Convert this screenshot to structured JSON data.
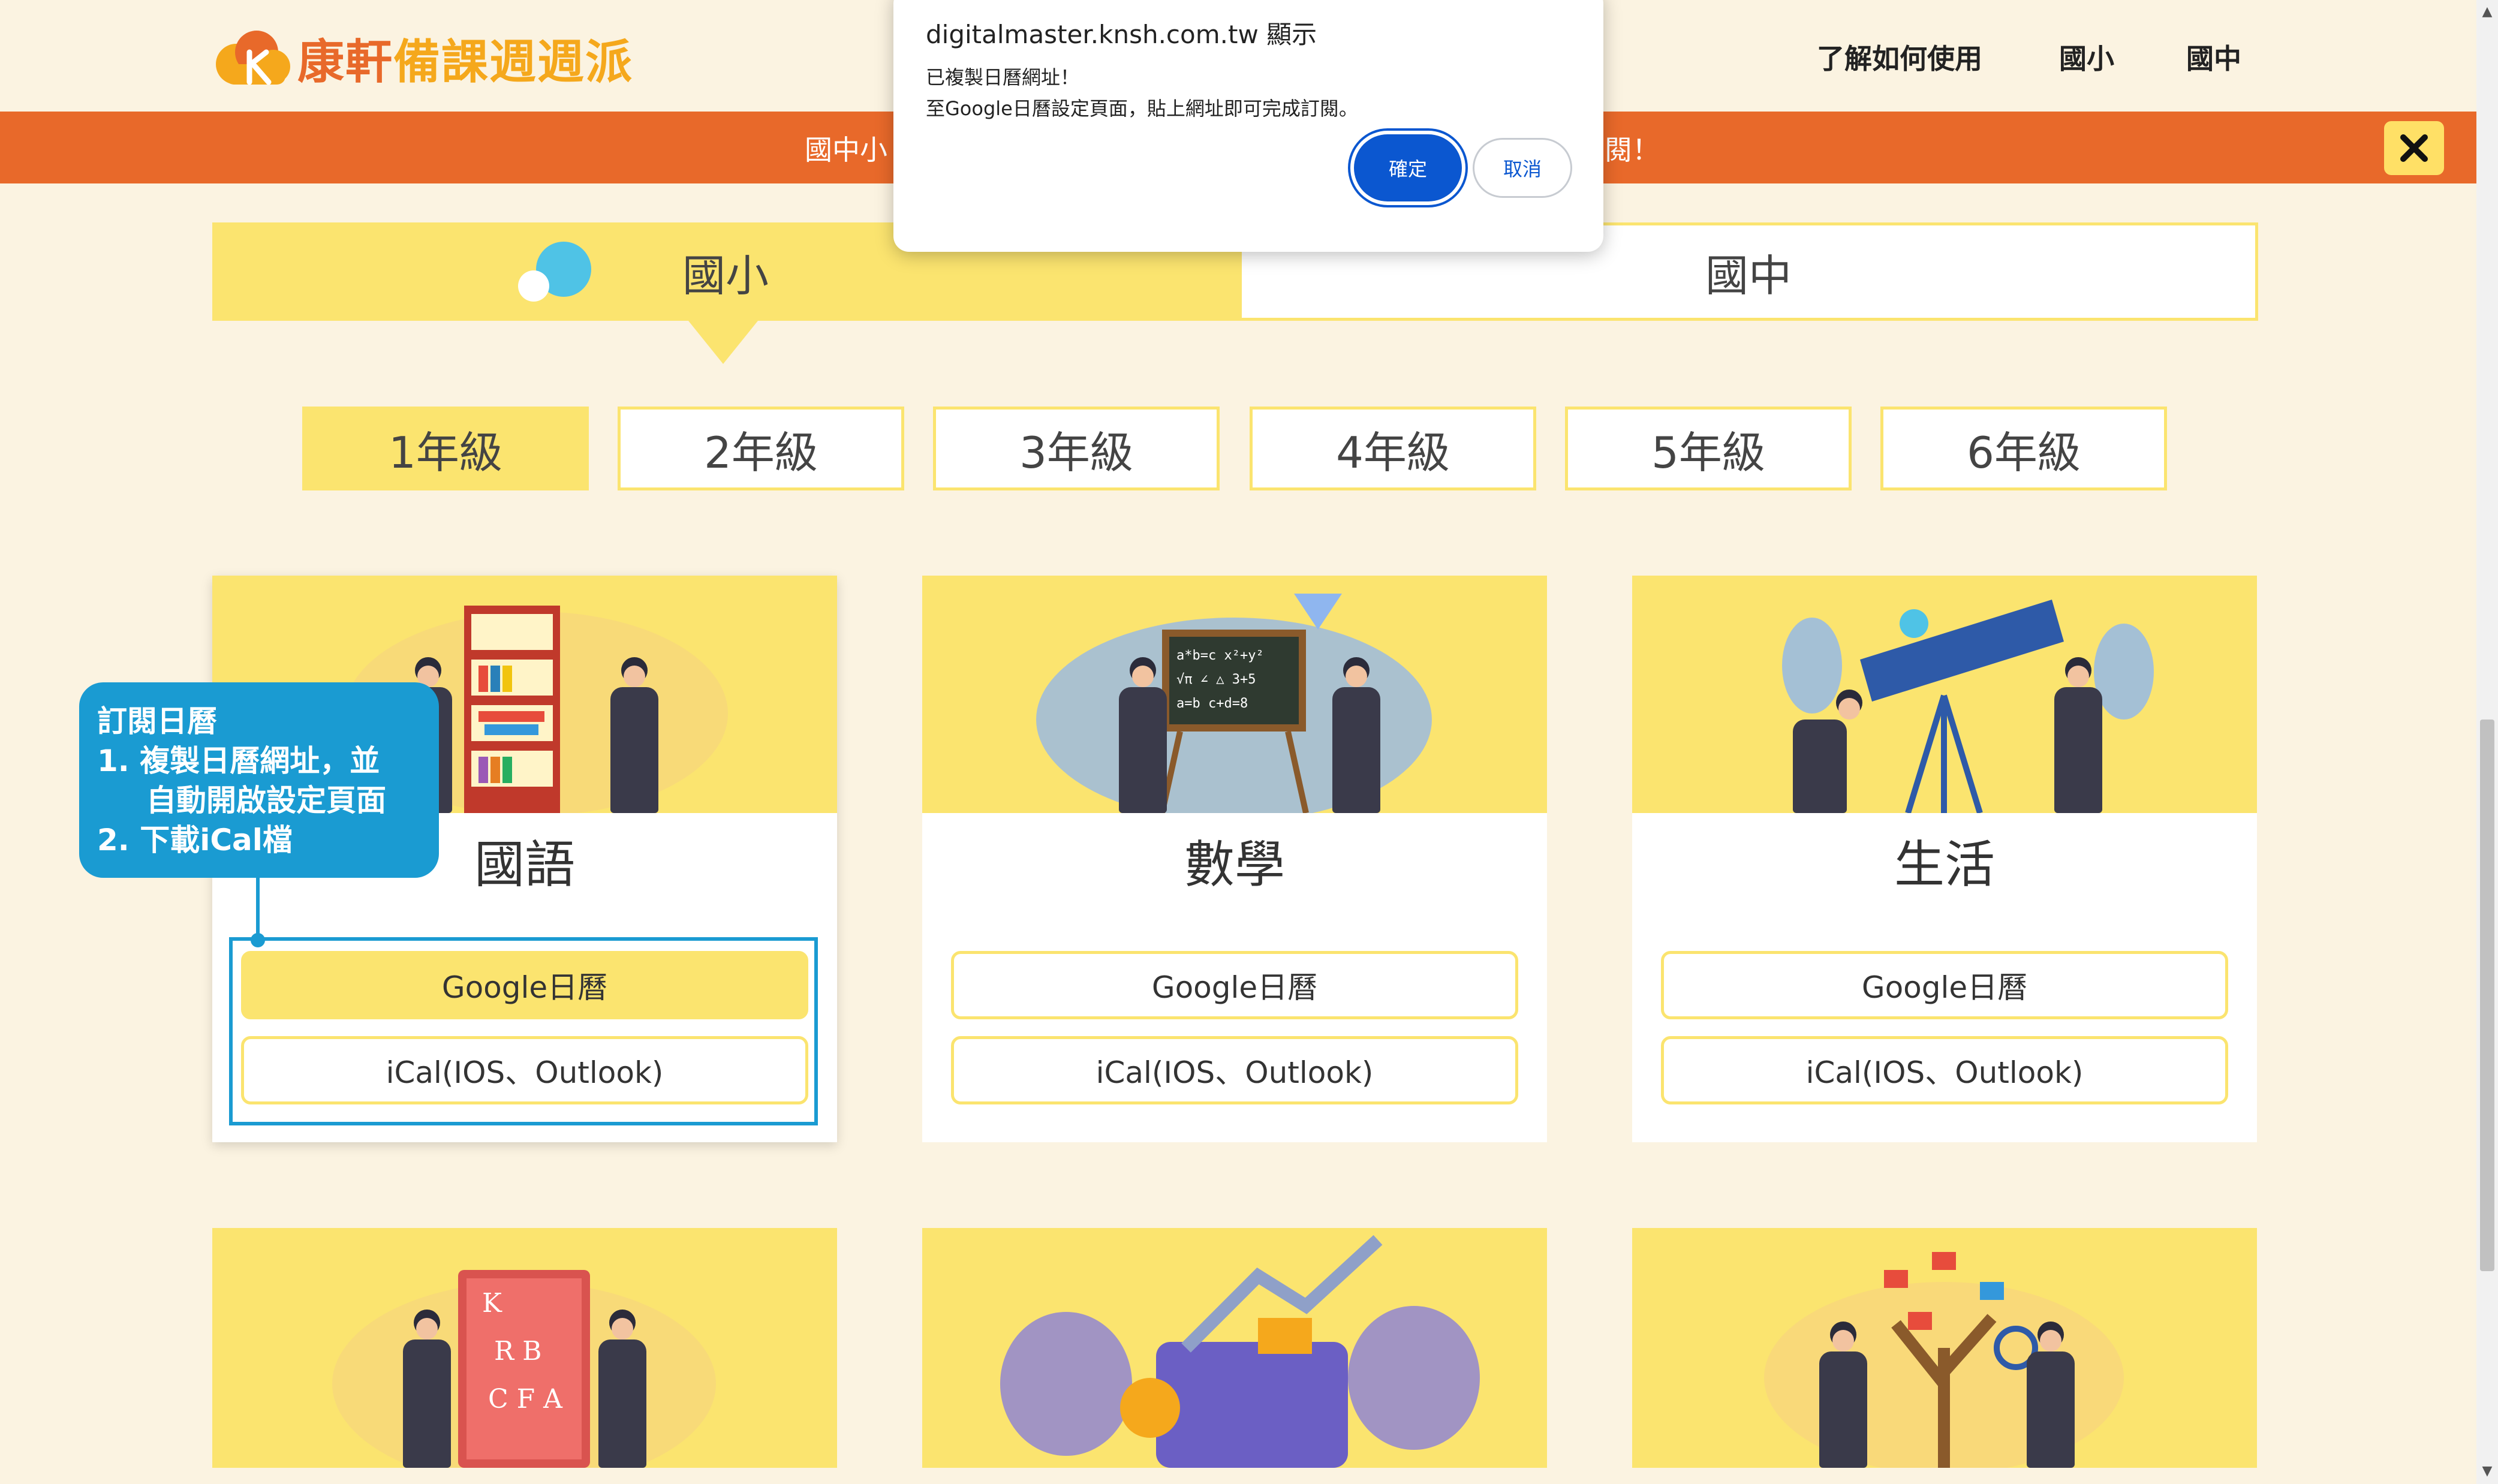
{
  "header": {
    "brand_main": "康軒",
    "brand_sub": "備課週週派",
    "nav": [
      "了解如何使用",
      "國小",
      "國中"
    ]
  },
  "banner": {
    "text_left": "國中小",
    "text_right": "閱！"
  },
  "dialog": {
    "title": "digitalmaster.knsh.com.tw 顯示",
    "message_line1": "已複製日曆網址！",
    "message_line2": "至Google日曆設定頁面，貼上網址即可完成訂閱。",
    "ok_label": "確定",
    "cancel_label": "取消"
  },
  "level_tabs": [
    {
      "label": "國小",
      "active": true
    },
    {
      "label": "國中",
      "active": false
    }
  ],
  "grades": [
    {
      "label": "1年級",
      "active": true
    },
    {
      "label": "2年級",
      "active": false
    },
    {
      "label": "3年級",
      "active": false
    },
    {
      "label": "4年級",
      "active": false
    },
    {
      "label": "5年級",
      "active": false
    },
    {
      "label": "6年級",
      "active": false
    }
  ],
  "subjects": [
    {
      "title": "國語",
      "google_label": "Google日曆",
      "ical_label": "iCal(IOS、Outlook)"
    },
    {
      "title": "數學",
      "google_label": "Google日曆",
      "ical_label": "iCal(IOS、Outlook)"
    },
    {
      "title": "生活",
      "google_label": "Google日曆",
      "ical_label": "iCal(IOS、Outlook)"
    }
  ],
  "callout": {
    "title": "訂閱日曆",
    "step1_line1": "1.  複製日曆網址，並",
    "step1_line2": "自動開啟設定頁面",
    "step2": "2.  下載iCal檔"
  },
  "icons": {
    "logo": "cloud-logo-icon",
    "close": "close-icon"
  },
  "colors": {
    "accent_orange": "#e8692a",
    "accent_yellow": "#fbe46f",
    "callout_blue": "#1a9bd2",
    "dialog_blue": "#0b57d0",
    "background": "#fbf3e1"
  }
}
